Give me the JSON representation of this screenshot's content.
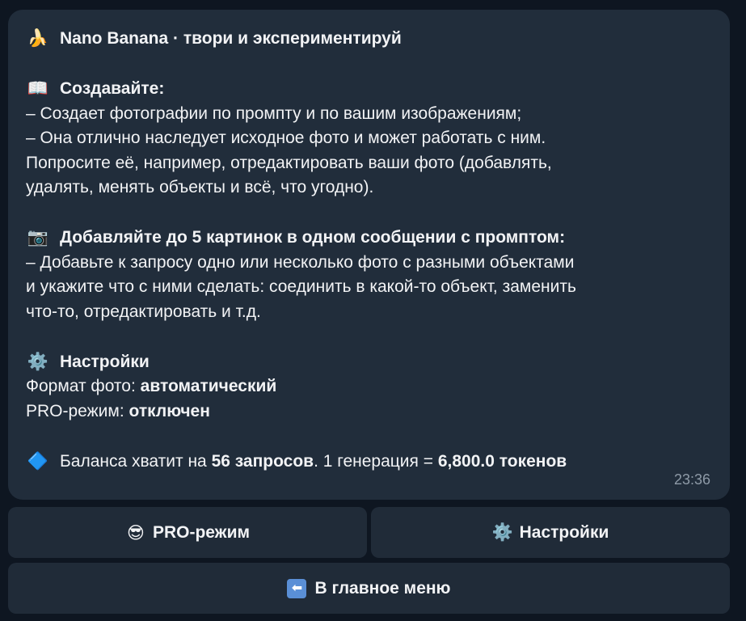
{
  "message": {
    "header": {
      "icon": "banana-icon",
      "emoji": "🍌",
      "title": "Nano Banana · твори и экспериментируй"
    },
    "create": {
      "icon": "book-icon",
      "emoji": "📖",
      "heading": "Создавайте:",
      "lines": [
        "– Создает фотографии по промпту и по вашим изображениям;",
        "– Она отлично наследует исходное фото и может работать с ним.",
        "Попросите её, например, отредактировать ваши фото (добавлять,",
        "удалять, менять объекты и всё, что угодно)."
      ]
    },
    "add_images": {
      "icon": "camera-icon",
      "emoji": "📷",
      "heading": "Добавляйте до 5 картинок в одном сообщении с промптом:",
      "lines": [
        "– Добавьте к запросу одно или несколько фото с разными объектами",
        "и укажите что с ними сделать: соединить в какой-то объект, заменить",
        "что-то, отредактировать и т.д."
      ]
    },
    "settings": {
      "icon": "gear-icon",
      "emoji": "⚙️",
      "heading": "Настройки",
      "format_label": "Формат фото: ",
      "format_value": "автоматический",
      "pro_label": "PRO-режим: ",
      "pro_value": "отключен"
    },
    "balance": {
      "icon": "blue-diamond-icon",
      "emoji": "🔷",
      "prefix": "Баланса хватит на ",
      "requests": "56 запросов",
      "middle": ". 1 генерация = ",
      "tokens": "6,800.0 токенов"
    },
    "time": "23:36"
  },
  "keyboard": {
    "pro": {
      "icon": "sunglasses-icon",
      "emoji": "😎",
      "label": "PRO-режим"
    },
    "settings": {
      "icon": "gear-icon",
      "emoji": "⚙️",
      "label": "Настройки"
    },
    "menu": {
      "icon": "back-arrow-icon",
      "glyph": "⬅",
      "label": "В главное меню"
    }
  }
}
